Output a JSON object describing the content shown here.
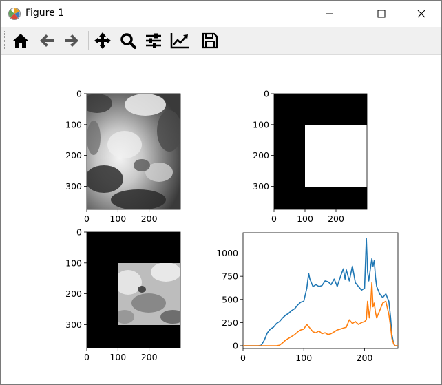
{
  "window": {
    "title": "Figure 1"
  },
  "toolbar": {
    "buttons": [
      {
        "name": "home-button",
        "icon": "home-icon"
      },
      {
        "name": "back-button",
        "icon": "arrow-left-icon"
      },
      {
        "name": "forward-button",
        "icon": "arrow-right-icon"
      },
      {
        "name": "pan-button",
        "icon": "move-icon"
      },
      {
        "name": "zoom-button",
        "icon": "zoom-icon"
      },
      {
        "name": "subplots-button",
        "icon": "sliders-icon"
      },
      {
        "name": "edit-axes-button",
        "icon": "line-chart-icon"
      },
      {
        "name": "save-button",
        "icon": "save-icon"
      }
    ]
  },
  "chart_data": [
    {
      "type": "image",
      "description_label": "grayscale image",
      "xticks": [
        "0",
        "100",
        "200"
      ],
      "yticks": [
        "0",
        "100",
        "200",
        "300"
      ],
      "xlim": [
        0,
        300
      ],
      "ylim": [
        375,
        0
      ]
    },
    {
      "type": "image",
      "description_label": "binary mask",
      "mask_rect": {
        "x0": 100,
        "x1": 300,
        "y0": 100,
        "y1": 300
      },
      "xticks": [
        "0",
        "100",
        "200"
      ],
      "yticks": [
        "0",
        "100",
        "200",
        "300"
      ],
      "xlim": [
        0,
        300
      ],
      "ylim": [
        375,
        0
      ]
    },
    {
      "type": "image",
      "description_label": "masked image",
      "mask_rect": {
        "x0": 100,
        "x1": 300,
        "y0": 100,
        "y1": 300
      },
      "xticks": [
        "0",
        "100",
        "200"
      ],
      "yticks": [
        "0",
        "100",
        "200",
        "300"
      ],
      "xlim": [
        0,
        300
      ],
      "ylim": [
        375,
        0
      ]
    },
    {
      "type": "line",
      "xlim": [
        0,
        255
      ],
      "ylim": [
        -30,
        1220
      ],
      "xticks": [
        0,
        100,
        200
      ],
      "yticks": [
        0,
        250,
        500,
        750,
        1000
      ],
      "series": [
        {
          "color": "#1f77b4",
          "x": [
            0,
            25,
            30,
            35,
            40,
            45,
            50,
            55,
            60,
            65,
            70,
            75,
            80,
            85,
            90,
            95,
            100,
            105,
            108,
            110,
            115,
            120,
            125,
            130,
            135,
            140,
            145,
            150,
            155,
            160,
            165,
            168,
            170,
            175,
            180,
            185,
            190,
            195,
            200,
            203,
            205,
            207,
            210,
            212,
            214,
            216,
            218,
            220,
            225,
            230,
            235,
            240,
            243,
            245,
            248,
            250,
            255
          ],
          "y": [
            0,
            0,
            5,
            60,
            140,
            180,
            200,
            240,
            260,
            300,
            330,
            350,
            380,
            400,
            440,
            470,
            480,
            620,
            780,
            720,
            640,
            660,
            640,
            650,
            700,
            690,
            660,
            720,
            640,
            740,
            830,
            720,
            820,
            700,
            860,
            680,
            640,
            600,
            620,
            1160,
            800,
            700,
            850,
            940,
            860,
            920,
            740,
            640,
            560,
            520,
            560,
            480,
            300,
            120,
            20,
            0,
            0
          ]
        },
        {
          "color": "#ff7f0e",
          "x": [
            0,
            55,
            60,
            65,
            70,
            75,
            80,
            85,
            90,
            95,
            100,
            105,
            110,
            115,
            120,
            125,
            130,
            135,
            140,
            145,
            150,
            155,
            160,
            165,
            170,
            175,
            180,
            185,
            190,
            195,
            200,
            203,
            205,
            208,
            210,
            212,
            214,
            216,
            218,
            220,
            225,
            230,
            235,
            240,
            243,
            245,
            248,
            250,
            255
          ],
          "y": [
            0,
            0,
            5,
            30,
            60,
            80,
            100,
            120,
            150,
            170,
            180,
            230,
            190,
            150,
            140,
            160,
            130,
            140,
            120,
            130,
            150,
            170,
            180,
            190,
            200,
            280,
            240,
            260,
            230,
            250,
            260,
            280,
            480,
            300,
            440,
            680,
            420,
            460,
            360,
            300,
            380,
            460,
            480,
            340,
            200,
            80,
            20,
            0,
            0
          ]
        }
      ],
      "ytick_labels": [
        "0",
        "250",
        "500",
        "750",
        "1000"
      ],
      "xtick_labels": [
        "0",
        "100",
        "200"
      ]
    }
  ]
}
